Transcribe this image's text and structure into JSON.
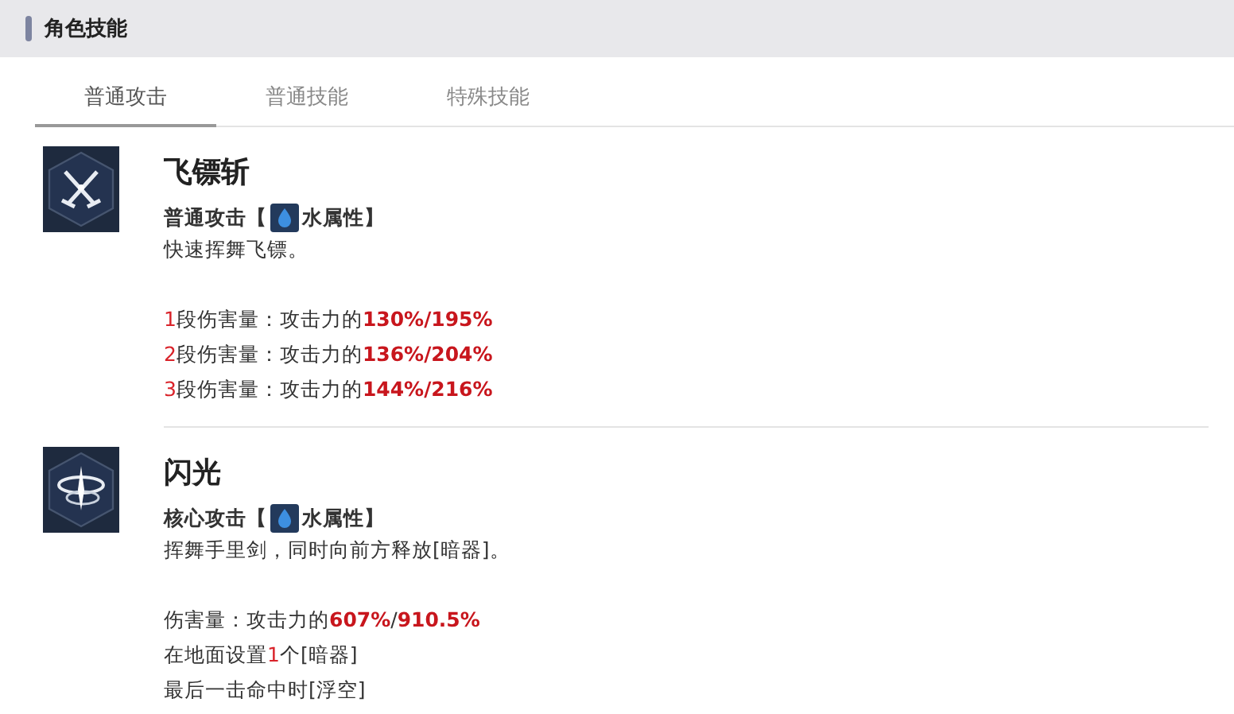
{
  "section_title": "角色技能",
  "tabs": [
    {
      "label": "普通攻击",
      "selected": true
    },
    {
      "label": "普通技能",
      "selected": false
    },
    {
      "label": "特殊技能",
      "selected": false
    }
  ],
  "skills": [
    {
      "name": "飞镖斩",
      "kind": "swords",
      "type_label": "普通攻击【",
      "element": "水属性】",
      "description": "快速挥舞飞镖。",
      "stats": [
        [
          {
            "text": "1",
            "kind": "red"
          },
          {
            "text": "段伤害量：攻击力的",
            "kind": "plain"
          },
          {
            "text": "130%/195%",
            "kind": "red-bold"
          }
        ],
        [
          {
            "text": "2",
            "kind": "red"
          },
          {
            "text": "段伤害量：攻击力的",
            "kind": "plain"
          },
          {
            "text": "136%/204%",
            "kind": "red-bold"
          }
        ],
        [
          {
            "text": "3",
            "kind": "red"
          },
          {
            "text": "段伤害量：攻击力的",
            "kind": "plain"
          },
          {
            "text": "144%/216%",
            "kind": "red-bold"
          }
        ]
      ]
    },
    {
      "name": "闪光",
      "kind": "swirl",
      "type_label": "核心攻击【",
      "element": "水属性】",
      "description": "挥舞手里剑，同时向前方释放[暗器]。",
      "stats": [
        [
          {
            "text": "伤害量：攻击力的",
            "kind": "plain"
          },
          {
            "text": "607%",
            "kind": "red-bold"
          },
          {
            "text": "/",
            "kind": "plain"
          },
          {
            "text": "910.5%",
            "kind": "red-bold"
          }
        ],
        [
          {
            "text": "在地面设置",
            "kind": "plain"
          },
          {
            "text": "1",
            "kind": "red"
          },
          {
            "text": "个[暗器]",
            "kind": "plain"
          }
        ],
        [
          {
            "text": "最后一击命中时[浮空]",
            "kind": "plain"
          }
        ]
      ]
    }
  ]
}
